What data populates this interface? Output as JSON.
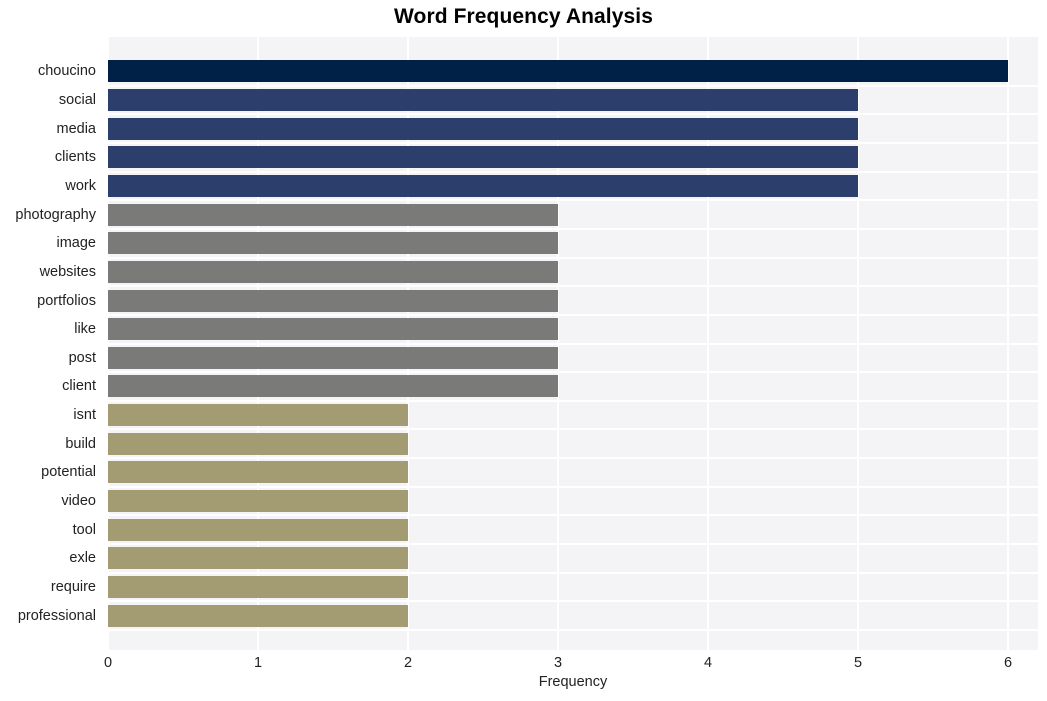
{
  "chart_data": {
    "type": "bar",
    "orientation": "horizontal",
    "title": "Word Frequency Analysis",
    "xlabel": "Frequency",
    "ylabel": "",
    "xlim": [
      0,
      6.2
    ],
    "xticks": [
      "0",
      "1",
      "2",
      "3",
      "4",
      "5",
      "6"
    ],
    "xtick_values": [
      0,
      1,
      2,
      3,
      4,
      5,
      6
    ],
    "grid": true,
    "legend": null,
    "categories": [
      "choucino",
      "social",
      "media",
      "clients",
      "work",
      "photography",
      "image",
      "websites",
      "portfolios",
      "like",
      "post",
      "client",
      "isnt",
      "build",
      "potential",
      "video",
      "tool",
      "exle",
      "require",
      "professional"
    ],
    "values": [
      6,
      5,
      5,
      5,
      5,
      3,
      3,
      3,
      3,
      3,
      3,
      3,
      2,
      2,
      2,
      2,
      2,
      2,
      2,
      2
    ],
    "bar_colors": [
      "#002147",
      "#2c3e6b",
      "#2c3e6b",
      "#2c3e6b",
      "#2c3e6b",
      "#7a7a78",
      "#7a7a78",
      "#7a7a78",
      "#7a7a78",
      "#7a7a78",
      "#7a7a78",
      "#7a7a78",
      "#a39b72",
      "#a39b72",
      "#a39b72",
      "#a39b72",
      "#a39b72",
      "#a39b72",
      "#a39b72",
      "#a39b72"
    ],
    "plot_background": "#f4f4f6",
    "grid_color": "#ffffff",
    "title_color": "#000000",
    "tick_color": "#222222"
  }
}
